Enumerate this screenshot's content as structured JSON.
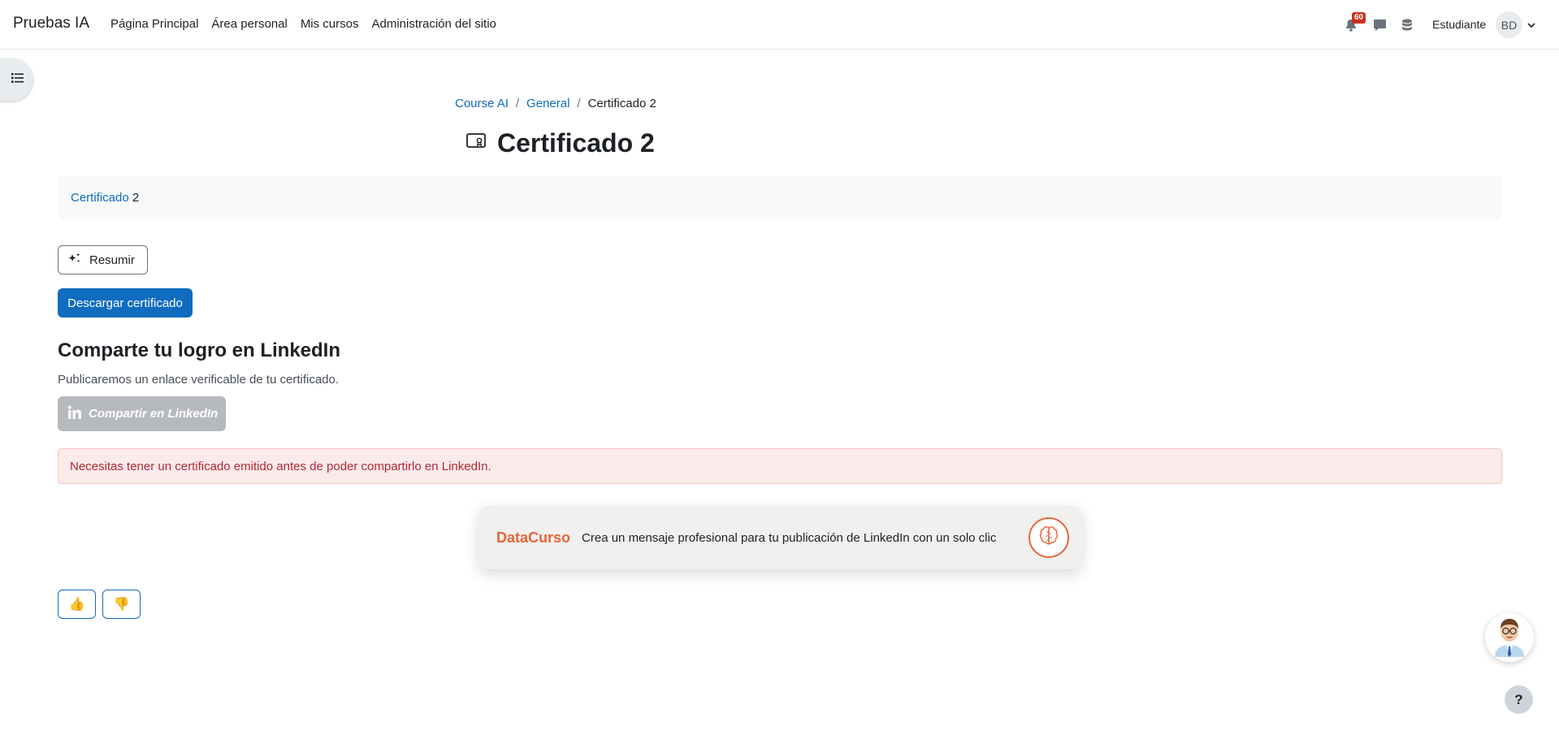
{
  "navbar": {
    "brand": "Pruebas IA",
    "links": [
      "Página Principal",
      "Área personal",
      "Mis cursos",
      "Administración del sitio"
    ],
    "notification_count": "60",
    "username": "Estudiante",
    "avatar_initials": "BD"
  },
  "breadcrumb": {
    "items": [
      "Course AI",
      "General"
    ],
    "current": "Certificado 2",
    "separator": "/"
  },
  "page": {
    "title": "Certificado 2",
    "activity_link": "Certificado",
    "activity_suffix": " 2"
  },
  "actions": {
    "resumir_label": "Resumir",
    "download_label": "Descargar certificado"
  },
  "linkedin": {
    "heading": "Comparte tu logro en LinkedIn",
    "description": "Publicaremos un enlace verificable de tu certificado.",
    "share_label": "Compartir en LinkedIn",
    "alert": "Necesitas tener un certificado emitido antes de poder compartirlo en LinkedIn."
  },
  "datacurso": {
    "brand": "DataCurso",
    "message": "Crea un mensaje profesional para tu publicación de LinkedIn con un solo clic"
  },
  "feedback": {
    "like": "👍",
    "dislike": "👎"
  },
  "help": {
    "label": "?"
  },
  "colors": {
    "primary": "#0f6cbf",
    "danger_text": "#b02a37",
    "danger_bg": "#fbeaea",
    "datacurso_accent": "#e8643b",
    "disabled_btn": "#b6b9bd"
  }
}
